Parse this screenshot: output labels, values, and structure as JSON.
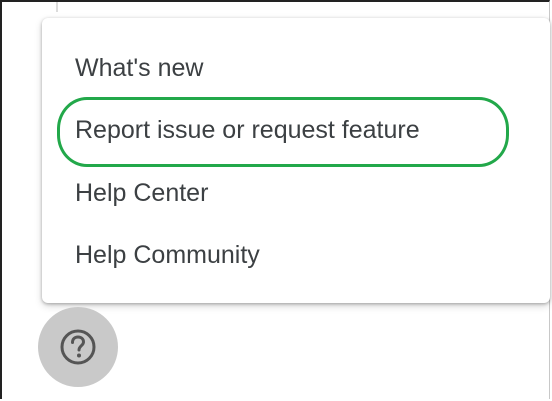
{
  "help_menu": {
    "items": [
      {
        "label": "What's new"
      },
      {
        "label": "Report issue or request feature",
        "highlighted": true
      },
      {
        "label": "Help Center"
      },
      {
        "label": "Help Community"
      }
    ]
  },
  "help_button": {
    "icon": "help-circle-icon"
  },
  "colors": {
    "highlight": "#22a84a",
    "menu_text": "#3c4043",
    "fab_background": "#c9c9c9"
  }
}
